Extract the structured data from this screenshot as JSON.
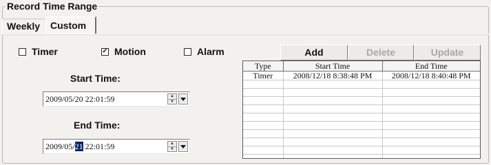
{
  "group": {
    "title": "Record Time Range"
  },
  "tabs": [
    {
      "label": "Weekly"
    },
    {
      "label": "Custom"
    }
  ],
  "checkboxes": [
    {
      "label": "Timer",
      "checked": false
    },
    {
      "label": "Motion",
      "checked": true
    },
    {
      "label": "Alarm",
      "checked": false
    }
  ],
  "start": {
    "label": "Start Time:",
    "value": "2009/05/20 22:01:59"
  },
  "end": {
    "label": "End Time:",
    "value_prefix": "2009/05/",
    "value_selected": "21",
    "value_suffix": " 22:01:59"
  },
  "buttons": {
    "add": "Add",
    "delete": "Delete",
    "update": "Update"
  },
  "table": {
    "columns": [
      "Type",
      "Start Time",
      "End Time"
    ],
    "rows": [
      [
        "Timer",
        "2008/12/18 8:38:48 PM",
        "2008/12/18 8:40:48 PM"
      ]
    ]
  }
}
